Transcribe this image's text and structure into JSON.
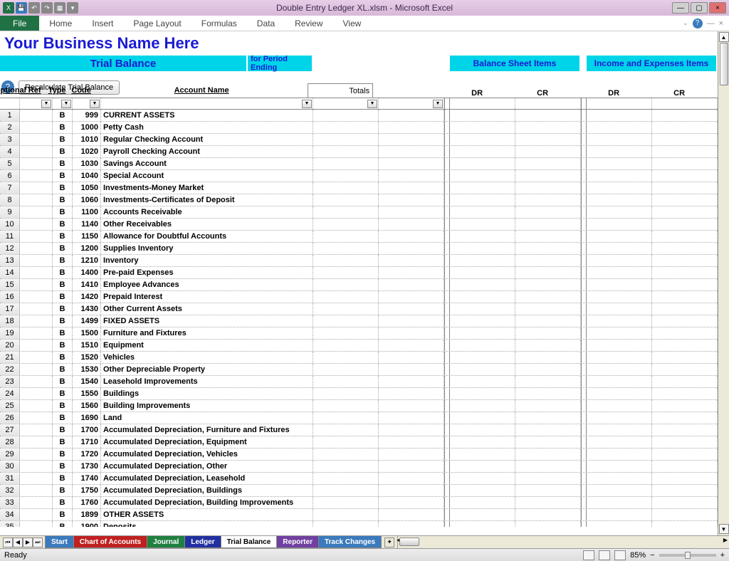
{
  "app": {
    "title": "Double Entry Ledger XL.xlsm  -  Microsoft Excel"
  },
  "ribbon": {
    "file": "File",
    "tabs": [
      "Home",
      "Insert",
      "Page Layout",
      "Formulas",
      "Data",
      "Review",
      "View"
    ]
  },
  "business_name": "Your Business Name Here",
  "band": {
    "trial_balance": "Trial Balance",
    "period": "for Period Ending",
    "balance_sheet": "Balance Sheet Items",
    "income": "Income and Expenses Items"
  },
  "buttons": {
    "recalc": "Recalculate Trial Balance"
  },
  "headers": {
    "optional_ref": "Optional Ref",
    "type": "Type",
    "code": "Code",
    "account_name": "Account Name",
    "totals": "Totals",
    "dr": "DR",
    "cr": "CR"
  },
  "rows": [
    {
      "n": 1,
      "type": "B",
      "code": "999",
      "name": "CURRENT ASSETS"
    },
    {
      "n": 2,
      "type": "B",
      "code": "1000",
      "name": "Petty Cash"
    },
    {
      "n": 3,
      "type": "B",
      "code": "1010",
      "name": "Regular Checking Account"
    },
    {
      "n": 4,
      "type": "B",
      "code": "1020",
      "name": "Payroll Checking Account"
    },
    {
      "n": 5,
      "type": "B",
      "code": "1030",
      "name": "Savings Account"
    },
    {
      "n": 6,
      "type": "B",
      "code": "1040",
      "name": "Special Account"
    },
    {
      "n": 7,
      "type": "B",
      "code": "1050",
      "name": "Investments-Money Market"
    },
    {
      "n": 8,
      "type": "B",
      "code": "1060",
      "name": "Investments-Certificates of Deposit"
    },
    {
      "n": 9,
      "type": "B",
      "code": "1100",
      "name": "Accounts Receivable"
    },
    {
      "n": 10,
      "type": "B",
      "code": "1140",
      "name": "Other Receivables"
    },
    {
      "n": 11,
      "type": "B",
      "code": "1150",
      "name": "Allowance for Doubtful Accounts"
    },
    {
      "n": 12,
      "type": "B",
      "code": "1200",
      "name": "Supplies Inventory"
    },
    {
      "n": 13,
      "type": "B",
      "code": "1210",
      "name": "Inventory"
    },
    {
      "n": 14,
      "type": "B",
      "code": "1400",
      "name": "Pre-paid Expenses"
    },
    {
      "n": 15,
      "type": "B",
      "code": "1410",
      "name": "Employee Advances"
    },
    {
      "n": 16,
      "type": "B",
      "code": "1420",
      "name": "Prepaid Interest"
    },
    {
      "n": 17,
      "type": "B",
      "code": "1430",
      "name": "Other Current Assets"
    },
    {
      "n": 18,
      "type": "B",
      "code": "1499",
      "name": "FIXED ASSETS"
    },
    {
      "n": 19,
      "type": "B",
      "code": "1500",
      "name": "Furniture and Fixtures"
    },
    {
      "n": 20,
      "type": "B",
      "code": "1510",
      "name": "Equipment"
    },
    {
      "n": 21,
      "type": "B",
      "code": "1520",
      "name": "Vehicles"
    },
    {
      "n": 22,
      "type": "B",
      "code": "1530",
      "name": "Other Depreciable Property"
    },
    {
      "n": 23,
      "type": "B",
      "code": "1540",
      "name": "Leasehold Improvements"
    },
    {
      "n": 24,
      "type": "B",
      "code": "1550",
      "name": "Buildings"
    },
    {
      "n": 25,
      "type": "B",
      "code": "1560",
      "name": "Building Improvements"
    },
    {
      "n": 26,
      "type": "B",
      "code": "1690",
      "name": "Land"
    },
    {
      "n": 27,
      "type": "B",
      "code": "1700",
      "name": "Accumulated Depreciation, Furniture and Fixtures"
    },
    {
      "n": 28,
      "type": "B",
      "code": "1710",
      "name": "Accumulated Depreciation, Equipment"
    },
    {
      "n": 29,
      "type": "B",
      "code": "1720",
      "name": "Accumulated Depreciation, Vehicles"
    },
    {
      "n": 30,
      "type": "B",
      "code": "1730",
      "name": "Accumulated Depreciation, Other"
    },
    {
      "n": 31,
      "type": "B",
      "code": "1740",
      "name": "Accumulated Depreciation, Leasehold"
    },
    {
      "n": 32,
      "type": "B",
      "code": "1750",
      "name": "Accumulated Depreciation, Buildings"
    },
    {
      "n": 33,
      "type": "B",
      "code": "1760",
      "name": "Accumulated Depreciation, Building Improvements"
    },
    {
      "n": 34,
      "type": "B",
      "code": "1899",
      "name": "OTHER ASSETS"
    },
    {
      "n": 35,
      "type": "B",
      "code": "1900",
      "name": "Deposits"
    }
  ],
  "sheet_tabs": [
    {
      "label": "Start",
      "color": "#3a7abd"
    },
    {
      "label": "Chart of Accounts",
      "color": "#c02020"
    },
    {
      "label": "Journal",
      "color": "#208040"
    },
    {
      "label": "Ledger",
      "color": "#2030a0"
    },
    {
      "label": "Trial Balance",
      "color": "#ffffff",
      "active": true
    },
    {
      "label": "Reporter",
      "color": "#7040a0"
    },
    {
      "label": "Track Changes",
      "color": "#3a7abd"
    }
  ],
  "status": {
    "ready": "Ready",
    "zoom": "85%"
  }
}
